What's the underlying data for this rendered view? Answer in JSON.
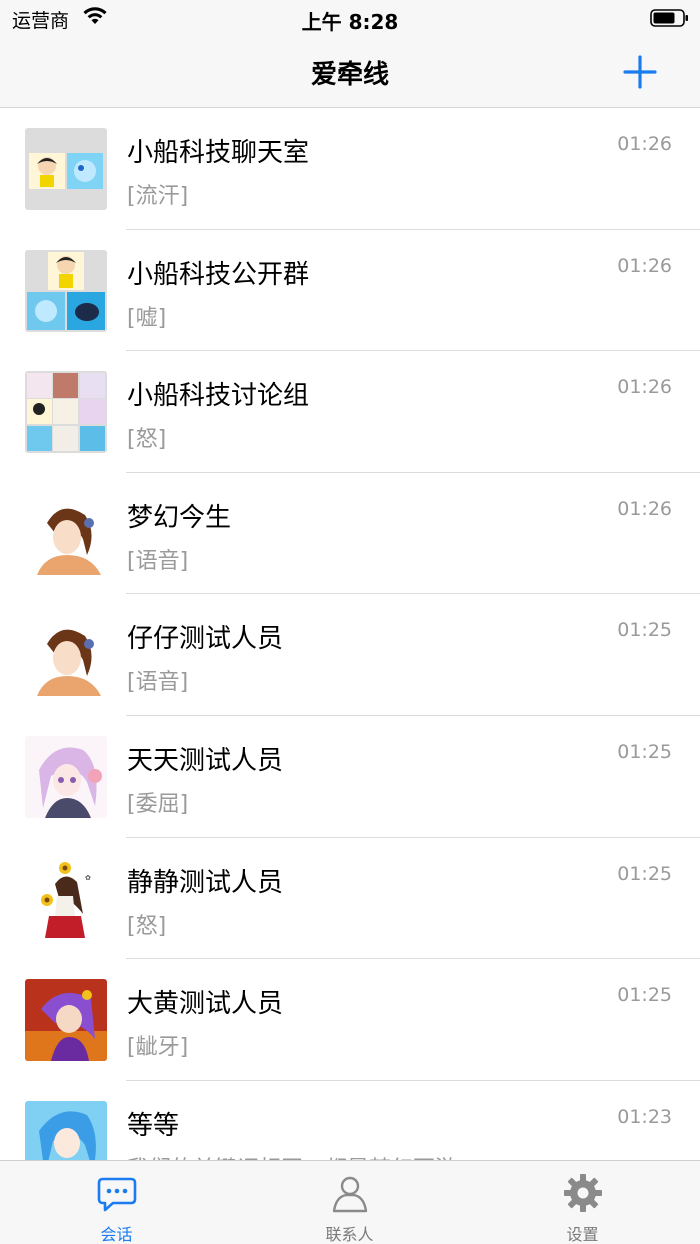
{
  "status_bar": {
    "carrier": "运营商",
    "time": "上午 8:28"
  },
  "nav": {
    "title": "爱牵线"
  },
  "conversations": [
    {
      "name": "小船科技聊天室",
      "preview": "[流汗]",
      "time": "01:26",
      "avatar": "group-avatar-2"
    },
    {
      "name": "小船科技公开群",
      "preview": "[嘘]",
      "time": "01:26",
      "avatar": "group-avatar-3"
    },
    {
      "name": "小船科技讨论组",
      "preview": "[怒]",
      "time": "01:26",
      "avatar": "group-avatar-9"
    },
    {
      "name": "梦幻今生",
      "preview": "[语音]",
      "time": "01:26",
      "avatar": "user-avatar-girl-brown"
    },
    {
      "name": "仔仔测试人员",
      "preview": "[语音]",
      "time": "01:25",
      "avatar": "user-avatar-girl-brown"
    },
    {
      "name": "天天测试人员",
      "preview": "[委屈]",
      "time": "01:25",
      "avatar": "user-avatar-girl-purple"
    },
    {
      "name": "静静测试人员",
      "preview": "[怒]",
      "time": "01:25",
      "avatar": "user-avatar-sunflower-girl"
    },
    {
      "name": "大黄测试人员",
      "preview": "[龇牙]",
      "time": "01:25",
      "avatar": "user-avatar-fantasy"
    },
    {
      "name": "等等",
      "preview": "我们的关键词相同，都是梦幻西游",
      "time": "01:23",
      "avatar": "user-avatar-blue-hair"
    }
  ],
  "tabs": [
    {
      "label": "会话",
      "icon": "chat-bubble-icon",
      "active": true
    },
    {
      "label": "联系人",
      "icon": "person-icon",
      "active": false
    },
    {
      "label": "设置",
      "icon": "gear-icon",
      "active": false
    }
  ],
  "colors": {
    "accent": "#1a7cf0",
    "bar_bg": "#f7f7f7",
    "secondary_text": "#9a9a9a"
  }
}
